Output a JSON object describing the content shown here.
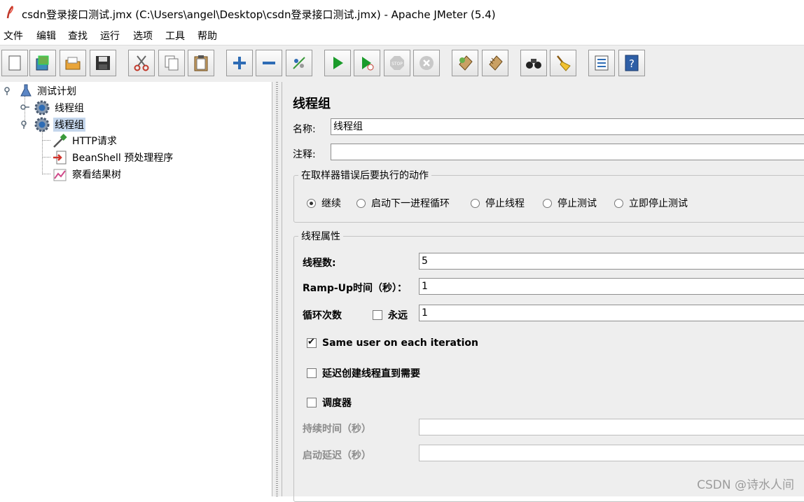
{
  "window": {
    "title": "csdn登录接口测试.jmx (C:\\Users\\angel\\Desktop\\csdn登录接口测试.jmx) - Apache JMeter (5.4)"
  },
  "menu": [
    "文件",
    "编辑",
    "查找",
    "运行",
    "选项",
    "工具",
    "帮助"
  ],
  "toolbar": [
    {
      "name": "new-button",
      "icon": "new-file-icon"
    },
    {
      "name": "templates-button",
      "icon": "templates-icon"
    },
    {
      "name": "open-button",
      "icon": "open-folder-icon"
    },
    {
      "name": "save-button",
      "icon": "save-icon"
    },
    {
      "name": "cut-button",
      "icon": "cut-icon"
    },
    {
      "name": "copy-button",
      "icon": "copy-icon"
    },
    {
      "name": "paste-button",
      "icon": "paste-icon"
    },
    {
      "name": "expand-all-button",
      "icon": "plus-icon"
    },
    {
      "name": "collapse-all-button",
      "icon": "minus-icon"
    },
    {
      "name": "toggle-button",
      "icon": "toggle-icon"
    },
    {
      "name": "start-button",
      "icon": "play-icon"
    },
    {
      "name": "start-no-pauses-button",
      "icon": "play-no-timers-icon"
    },
    {
      "name": "stop-button",
      "icon": "stop-icon"
    },
    {
      "name": "shutdown-button",
      "icon": "shutdown-icon"
    },
    {
      "name": "clear-button",
      "icon": "clear-icon"
    },
    {
      "name": "clear-all-button",
      "icon": "clear-all-icon"
    },
    {
      "name": "search-button",
      "icon": "binoculars-icon"
    },
    {
      "name": "reset-search-button",
      "icon": "broom-icon"
    },
    {
      "name": "function-helper-button",
      "icon": "list-icon"
    },
    {
      "name": "help-button",
      "icon": "help-icon"
    }
  ],
  "tree": {
    "root": "测试计划",
    "group1": "线程组",
    "group2": "线程组",
    "http": "HTTP请求",
    "beanshell": "BeanShell 预处理程序",
    "results": "察看结果树"
  },
  "panel": {
    "title": "线程组",
    "name_label": "名称:",
    "name_value": "线程组",
    "comment_label": "注释:",
    "comment_value": "",
    "error_group": "在取样器错误后要执行的动作",
    "actions": [
      {
        "label": "继续",
        "selected": true
      },
      {
        "label": "启动下一进程循环",
        "selected": false
      },
      {
        "label": "停止线程",
        "selected": false
      },
      {
        "label": "停止测试",
        "selected": false
      },
      {
        "label": "立即停止测试",
        "selected": false
      }
    ],
    "props_group": "线程属性",
    "threads_label": "线程数:",
    "threads_value": "5",
    "rampup_label": "Ramp-Up时间（秒）：",
    "rampup_value": "1",
    "loop_label": "循环次数",
    "forever_label": "永远",
    "forever_checked": false,
    "loop_value": "1",
    "same_user_label": "Same user on each iteration",
    "same_user_checked": true,
    "delay_label": "延迟创建线程直到需要",
    "delay_checked": false,
    "scheduler_label": "调度器",
    "scheduler_checked": false,
    "duration_label": "持续时间（秒）",
    "duration_value": "",
    "startup_delay_label": "启动延迟（秒）",
    "startup_delay_value": ""
  },
  "watermark": "CSDN @诗水人间"
}
